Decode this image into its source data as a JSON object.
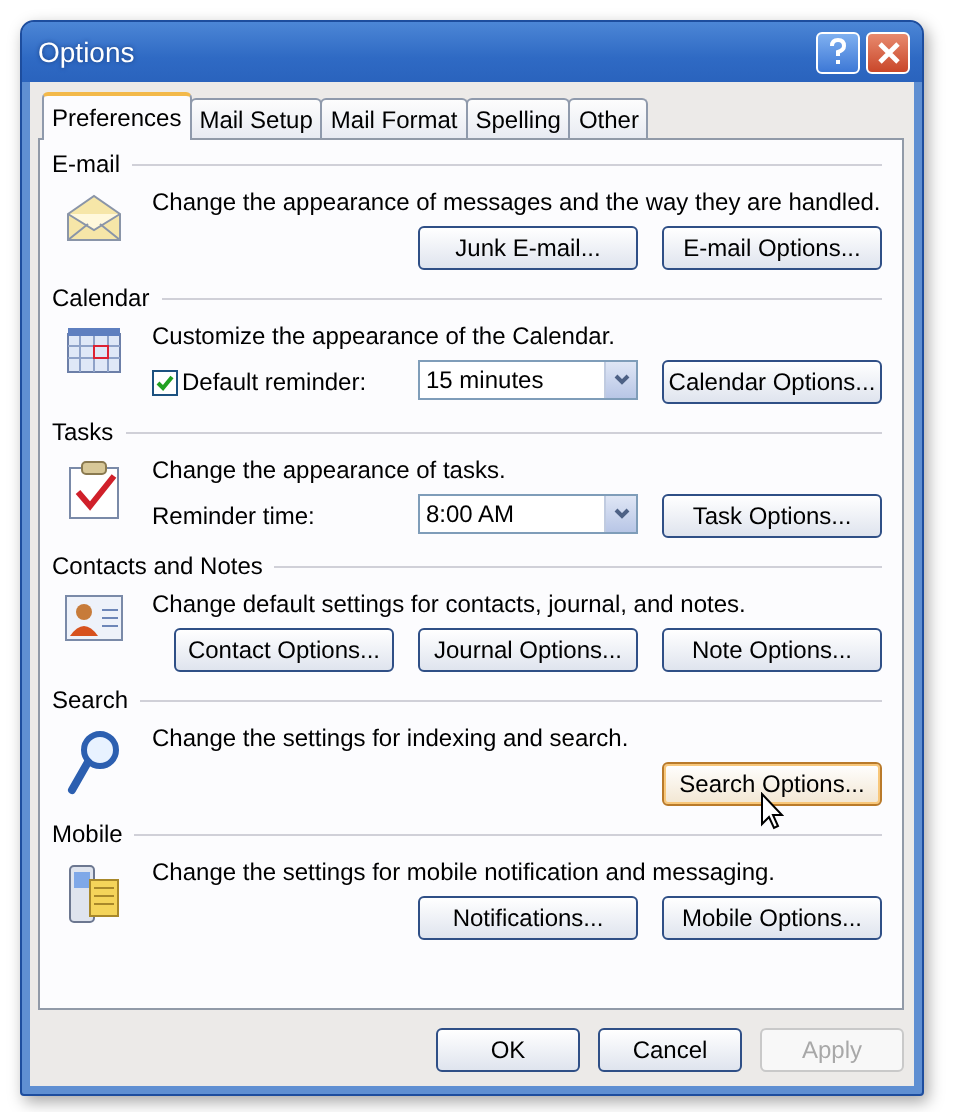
{
  "window": {
    "title": "Options"
  },
  "tabs": [
    {
      "label": "Preferences",
      "selected": true
    },
    {
      "label": "Mail Setup",
      "selected": false
    },
    {
      "label": "Mail Format",
      "selected": false
    },
    {
      "label": "Spelling",
      "selected": false
    },
    {
      "label": "Other",
      "selected": false
    }
  ],
  "sections": [
    {
      "title": "E-mail",
      "description": "Change the appearance of messages and the way they are handled.",
      "controls": [
        {
          "kind": "button",
          "label": "Junk E-mail...",
          "hovered": false
        },
        {
          "kind": "button",
          "label": "E-mail Options...",
          "hovered": false
        }
      ]
    },
    {
      "title": "Calendar",
      "description": "Customize the appearance of the Calendar.",
      "controls": [
        {
          "kind": "checkbox",
          "label": "Default reminder:",
          "checked": true
        },
        {
          "kind": "dropdown",
          "value": "15 minutes"
        },
        {
          "kind": "button",
          "label": "Calendar Options...",
          "hovered": false
        }
      ]
    },
    {
      "title": "Tasks",
      "description": "Change the appearance of tasks.",
      "controls": [
        {
          "kind": "label",
          "label": "Reminder time:"
        },
        {
          "kind": "dropdown",
          "value": "8:00 AM"
        },
        {
          "kind": "button",
          "label": "Task Options...",
          "hovered": false
        }
      ]
    },
    {
      "title": "Contacts and Notes",
      "description": "Change default settings for contacts, journal, and notes.",
      "controls": [
        {
          "kind": "button",
          "label": "Contact Options...",
          "hovered": false
        },
        {
          "kind": "button",
          "label": "Journal Options...",
          "hovered": false
        },
        {
          "kind": "button",
          "label": "Note Options...",
          "hovered": false
        }
      ]
    },
    {
      "title": "Search",
      "description": "Change the settings for indexing and search.",
      "controls": [
        {
          "kind": "button",
          "label": "Search Options...",
          "hovered": true
        }
      ]
    },
    {
      "title": "Mobile",
      "description": "Change the settings for mobile notification and messaging.",
      "controls": [
        {
          "kind": "button",
          "label": "Notifications...",
          "hovered": false
        },
        {
          "kind": "button",
          "label": "Mobile Options...",
          "hovered": false
        }
      ]
    }
  ],
  "dialog_buttons": [
    {
      "label": "OK",
      "disabled": false
    },
    {
      "label": "Cancel",
      "disabled": false
    },
    {
      "label": "Apply",
      "disabled": true
    }
  ]
}
